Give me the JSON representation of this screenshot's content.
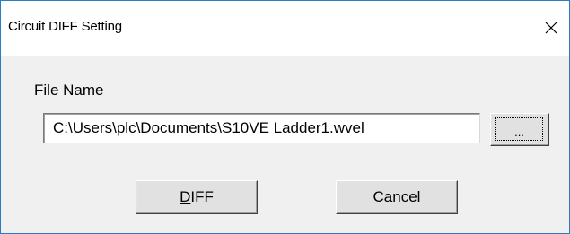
{
  "window": {
    "title": "Circuit DIFF Setting"
  },
  "form": {
    "file_name_label": "File Name",
    "file_name_value": "C:\\Users\\plc\\Documents\\S10VE Ladder1.wvel",
    "browse_label": "..."
  },
  "buttons": {
    "diff_mnemonic": "D",
    "diff_rest": "IFF",
    "cancel_label": "Cancel"
  },
  "icons": {
    "close": "close-icon"
  }
}
